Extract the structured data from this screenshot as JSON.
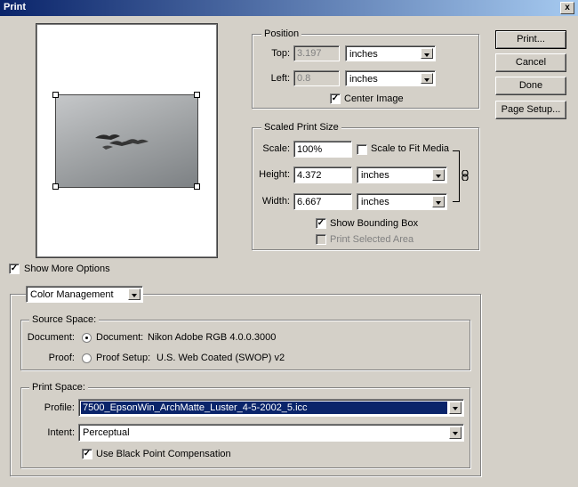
{
  "window": {
    "title": "Print",
    "close_label": "x"
  },
  "buttons": {
    "print": "Print...",
    "cancel": "Cancel",
    "done": "Done",
    "page_setup": "Page Setup..."
  },
  "position": {
    "legend": "Position",
    "top_label": "Top:",
    "top_value": "3.197",
    "top_unit": "inches",
    "left_label": "Left:",
    "left_value": "0.8",
    "left_unit": "inches",
    "center_label": "Center Image",
    "center_checked": true
  },
  "scaled": {
    "legend": "Scaled Print Size",
    "scale_label": "Scale:",
    "scale_value": "100%",
    "fit_label": "Scale to Fit Media",
    "height_label": "Height:",
    "height_value": "4.372",
    "height_unit": "inches",
    "width_label": "Width:",
    "width_value": "6.667",
    "width_unit": "inches",
    "bounding_label": "Show Bounding Box",
    "selected_area_label": "Print Selected Area"
  },
  "more_options": {
    "label": "Show More Options",
    "checked": true
  },
  "color_mgmt": {
    "dropdown": "Color Management"
  },
  "source": {
    "legend": "Source Space:",
    "document_label": "Document:",
    "document_option": "Document:",
    "document_value": "Nikon Adobe RGB 4.0.0.3000",
    "proof_label": "Proof:",
    "proof_option": "Proof Setup:",
    "proof_value": "U.S. Web Coated (SWOP) v2"
  },
  "print_space": {
    "legend": "Print Space:",
    "profile_label": "Profile:",
    "profile_value": "7500_EpsonWin_ArchMatte_Luster_4-5-2002_5.icc",
    "intent_label": "Intent:",
    "intent_value": "Perceptual",
    "bpc_label": "Use Black Point Compensation"
  },
  "icons": {
    "link": "chain-link-icon",
    "preview": "birds-in-fog-photo"
  }
}
